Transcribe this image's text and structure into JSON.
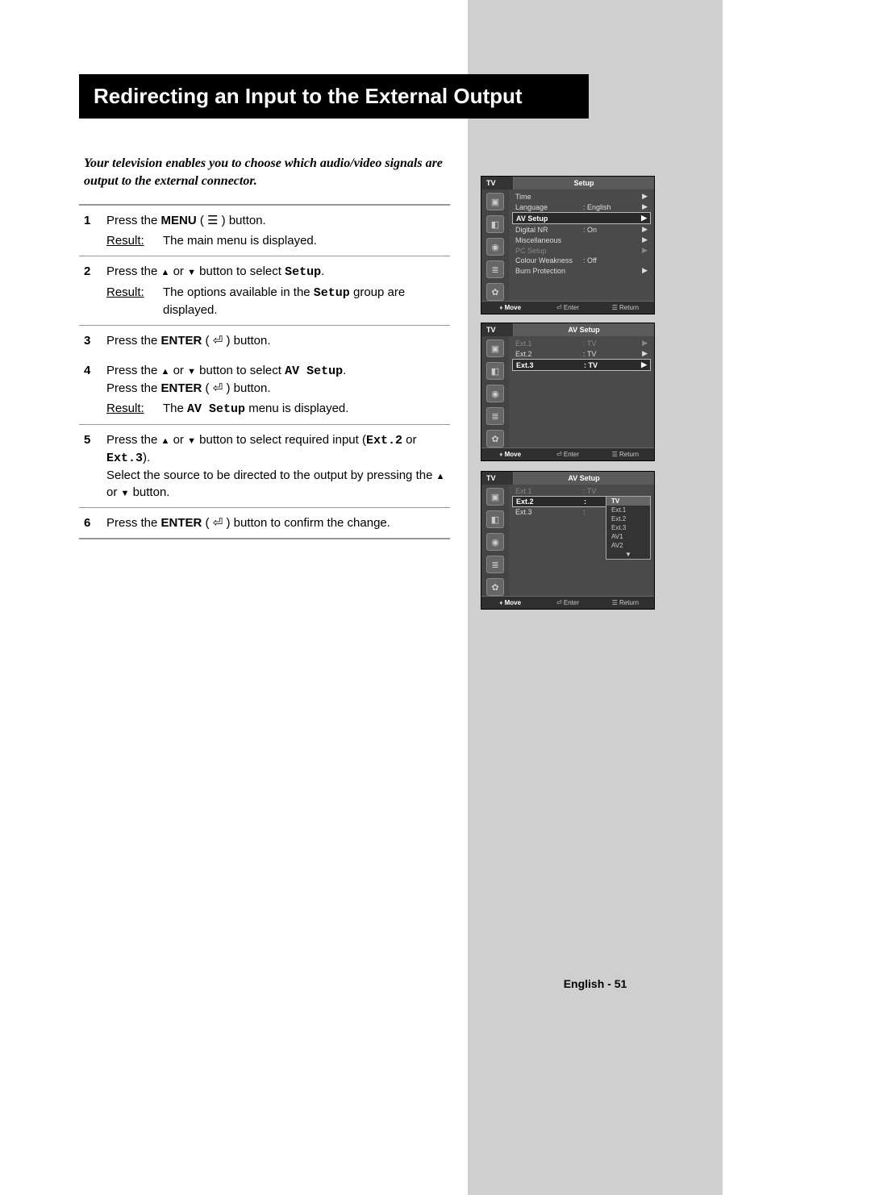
{
  "title": "Redirecting an Input to the External Output",
  "intro": "Your television enables you to choose which audio/video signals are output to the external connector.",
  "steps": {
    "s1": {
      "n": "1",
      "a": "Press the ",
      "menu": "MENU",
      "b": " button.",
      "res": "The main menu is displayed."
    },
    "s2": {
      "n": "2",
      "a": "Press the ",
      "b": " button to select ",
      "setup": "Setup",
      "c": ".",
      "res_a": "The options available in the ",
      "res_b": " group are displayed."
    },
    "s3": {
      "n": "3",
      "a": "Press the ",
      "enter": "ENTER",
      "b": " button."
    },
    "s4": {
      "n": "4",
      "a": "Press the ",
      "b": " button to select ",
      "av": "AV Setup",
      "c": ".",
      "d": "Press the ",
      "e": " button.",
      "res_a": "The ",
      "res_b": " menu is displayed."
    },
    "s5": {
      "n": "5",
      "a": "Press the ",
      "b": " button to select required input (",
      "ext2": "Ext.2",
      "or": " or ",
      "ext3": "Ext.3",
      "bend": ").",
      "c": "Select the source to be directed to the output by pressing the ",
      "d": " button."
    },
    "s6": {
      "n": "6",
      "a": "Press the ",
      "enter": "ENTER",
      "b": " button to confirm the change."
    }
  },
  "result_label": "Result",
  "glyphs": {
    "up": "▲",
    "down": "▼",
    "enter": "⏎",
    "menu": "☰",
    "right": "▶"
  },
  "osd1": {
    "label": "TV",
    "title": "Setup",
    "rows": [
      {
        "k": "Time",
        "v": "",
        "arrow": true
      },
      {
        "k": "Language",
        "v": ": English",
        "arrow": true
      },
      {
        "k": "AV Setup",
        "v": "",
        "arrow": true,
        "sel": true
      },
      {
        "k": "Digital NR",
        "v": ": On",
        "arrow": true
      },
      {
        "k": "Miscellaneous",
        "v": "",
        "arrow": true
      },
      {
        "k": "PC Setup",
        "v": "",
        "arrow": true,
        "dim": true
      },
      {
        "k": "Colour Weakness",
        "v": ": Off"
      },
      {
        "k": "Burn Protection",
        "v": "",
        "arrow": true
      }
    ],
    "footer": {
      "move": "Move",
      "enter": "Enter",
      "return": "Return"
    }
  },
  "osd2": {
    "label": "TV",
    "title": "AV Setup",
    "rows": [
      {
        "k": "Ext.1",
        "v": ": TV",
        "arrow": true,
        "dim": true
      },
      {
        "k": "Ext.2",
        "v": ": TV",
        "arrow": true
      },
      {
        "k": "Ext.3",
        "v": ": TV",
        "arrow": true,
        "sel": true
      }
    ],
    "footer": {
      "move": "Move",
      "enter": "Enter",
      "return": "Return"
    }
  },
  "osd3": {
    "label": "TV",
    "title": "AV Setup",
    "rows": [
      {
        "k": "Ext.1",
        "v": ": TV",
        "dim": true
      },
      {
        "k": "Ext.2",
        "v": ":",
        "sel": true
      },
      {
        "k": "Ext.3",
        "v": ":"
      }
    ],
    "dropdown": [
      "TV",
      "Ext.1",
      "Ext.2",
      "Ext.3",
      "AV1",
      "AV2"
    ],
    "footer": {
      "move": "Move",
      "enter": "Enter",
      "return": "Return"
    }
  },
  "footer": "English - 51"
}
